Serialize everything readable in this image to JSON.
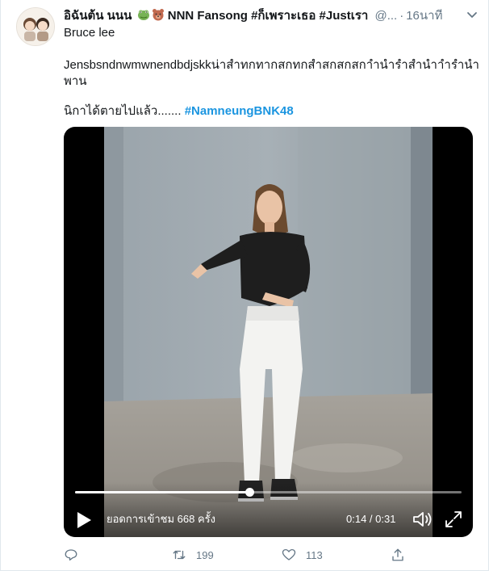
{
  "tweet": {
    "author_name": "อิฉันต้น นนน",
    "author_name_rest": "NNN Fansong #ก็เพราะเธอ #Justเรา",
    "handle": "@...",
    "time": "16นาที",
    "line1": "Bruce lee",
    "line2": "Jensbsndnwmwnendbdjskkน่าสำทกทากสกทกสำสกสกสกาำนำรำสำนำาำรำนำ",
    "line3": "พาน",
    "line4_text": "นิกาได้ตายไปแล้ว.......",
    "hashtag": "#NamneungBNK48"
  },
  "video": {
    "views": "ยอดการเข้าชม 668 ครั้ง",
    "timecode": "0:14 / 0:31",
    "progress_fraction": 0.45
  },
  "actions": {
    "retweets": "199",
    "likes": "113"
  },
  "colors": {
    "accent": "#1b95e0",
    "muted": "#657786",
    "text": "#14171a"
  },
  "icons": [
    "avatar",
    "frog-emoji-icon",
    "bear-emoji-icon",
    "caret-down-icon",
    "play-icon",
    "volume-icon",
    "fullscreen-icon",
    "reply-icon",
    "retweet-icon",
    "like-icon",
    "share-icon"
  ]
}
